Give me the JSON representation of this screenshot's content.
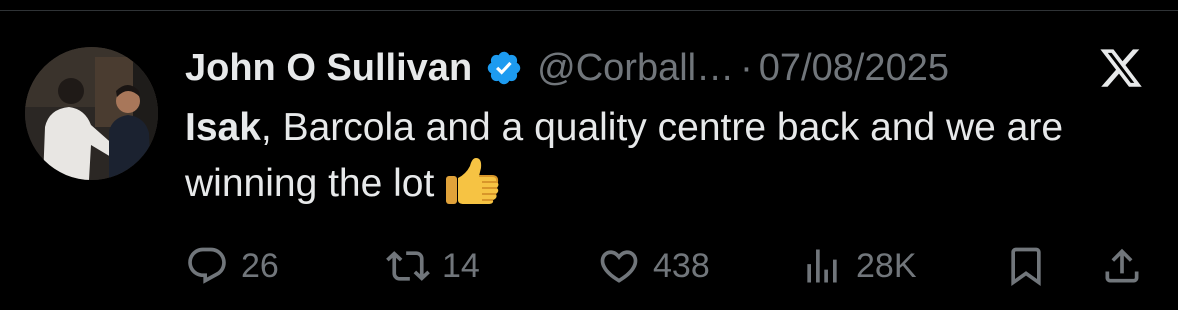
{
  "tweet": {
    "author_name": "John O Sullivan",
    "handle": "@Corball…",
    "separator": "·",
    "date": "07/08/2025",
    "text_mention": "Isak",
    "text_body": ", Barcola and a quality centre back and we are winning the lot",
    "emoji": "thumbs-up-emoji"
  },
  "actions": {
    "replies": "26",
    "retweets": "14",
    "likes": "438",
    "views": "28K"
  },
  "icons": {
    "verified": "verified-badge-icon",
    "brand": "x-logo-icon",
    "reply": "reply-icon",
    "retweet": "retweet-icon",
    "like": "heart-icon",
    "views": "views-icon",
    "bookmark": "bookmark-icon",
    "share": "share-icon"
  },
  "colors": {
    "background": "#000000",
    "text_primary": "#e7e9ea",
    "text_secondary": "#71767b",
    "verified_blue": "#1d9bf0"
  }
}
